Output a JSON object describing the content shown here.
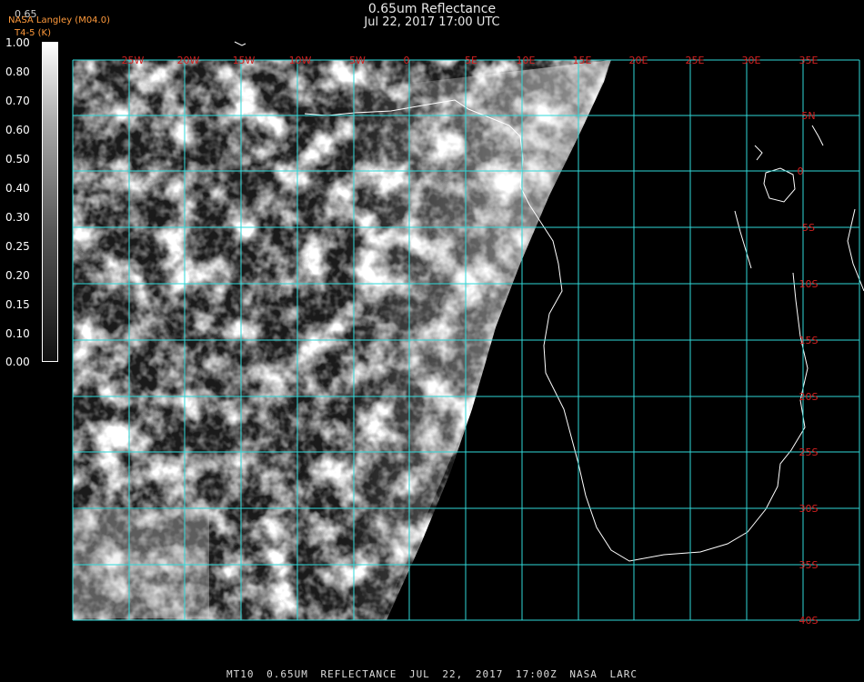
{
  "header": {
    "title": "0.65um Reflectance",
    "datetime": "Jul 22, 2017 17:00 UTC"
  },
  "source": {
    "org": "NASA Langley (M04.0)",
    "temp_label": "T4-5 (K)",
    "cbar_top_label": "0.65"
  },
  "colorbar": {
    "ticks": [
      "1.00",
      "0.80",
      "0.70",
      "0.60",
      "0.50",
      "0.40",
      "0.30",
      "0.25",
      "0.20",
      "0.15",
      "0.10",
      "0.00"
    ]
  },
  "grid": {
    "lon_labels": [
      "25W",
      "20W",
      "15W",
      "10W",
      "5W",
      "0",
      "5E",
      "10E",
      "15E",
      "20E",
      "25E",
      "30E",
      "35E"
    ],
    "lat_labels": [
      "5N",
      "0",
      "5S",
      "10S",
      "15S",
      "20S",
      "25S",
      "30S",
      "35S",
      "40S"
    ]
  },
  "colors": {
    "grid": "#30d8d8",
    "grid_labels": "#d42020",
    "coastline": "#ffffff"
  },
  "footer": "MT10  0.65UM REFLECTANCE   JUL 22, 2017 17:00Z   NASA LARC"
}
